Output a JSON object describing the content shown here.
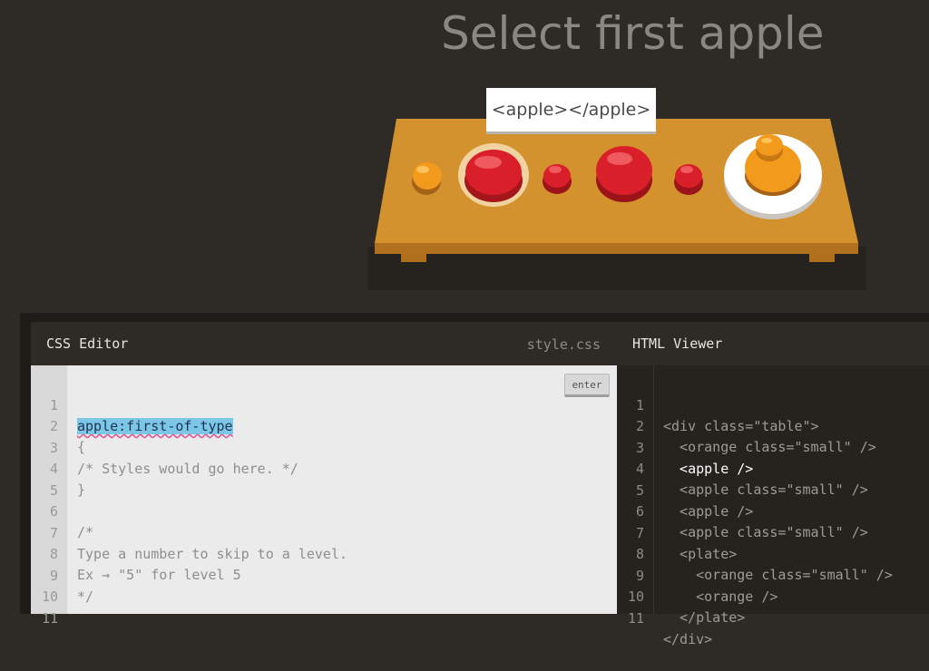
{
  "level_title": "Select first apple",
  "tooltip": "<apple></apple>",
  "css_editor": {
    "title": "CSS Editor",
    "filename": "style.css",
    "enter_label": "enter",
    "input_value": "apple:first-of-type",
    "lines": [
      {
        "num": "1",
        "text": ""
      },
      {
        "num": "2",
        "text": "{"
      },
      {
        "num": "3",
        "text": "/* Styles would go here. */"
      },
      {
        "num": "4",
        "text": "}"
      },
      {
        "num": "5",
        "text": ""
      },
      {
        "num": "6",
        "text": "/*"
      },
      {
        "num": "7",
        "text": "Type a number to skip to a level."
      },
      {
        "num": "8",
        "text": "Ex → \"5\" for level 5"
      },
      {
        "num": "9",
        "text": "*/"
      },
      {
        "num": "10",
        "text": ""
      },
      {
        "num": "11",
        "text": ""
      }
    ]
  },
  "html_viewer": {
    "title": "HTML Viewer",
    "lines": [
      {
        "num": "1",
        "text": "<div class=\"table\">"
      },
      {
        "num": "2",
        "text": "  <orange class=\"small\" />"
      },
      {
        "num": "3",
        "text": "  <apple />"
      },
      {
        "num": "4",
        "text": "  <apple class=\"small\" />"
      },
      {
        "num": "5",
        "text": "  <apple />"
      },
      {
        "num": "6",
        "text": "  <apple class=\"small\" />"
      },
      {
        "num": "7",
        "text": "  <plate>"
      },
      {
        "num": "8",
        "text": "    <orange class=\"small\" />"
      },
      {
        "num": "9",
        "text": "    <orange />"
      },
      {
        "num": "10",
        "text": "  </plate>"
      },
      {
        "num": "11",
        "text": "</div>"
      }
    ]
  },
  "colors": {
    "background": "#2e2a25",
    "table": "#d4922e",
    "apple": "#d9202a",
    "orange": "#f29a1c",
    "plate": "#ffffff"
  }
}
